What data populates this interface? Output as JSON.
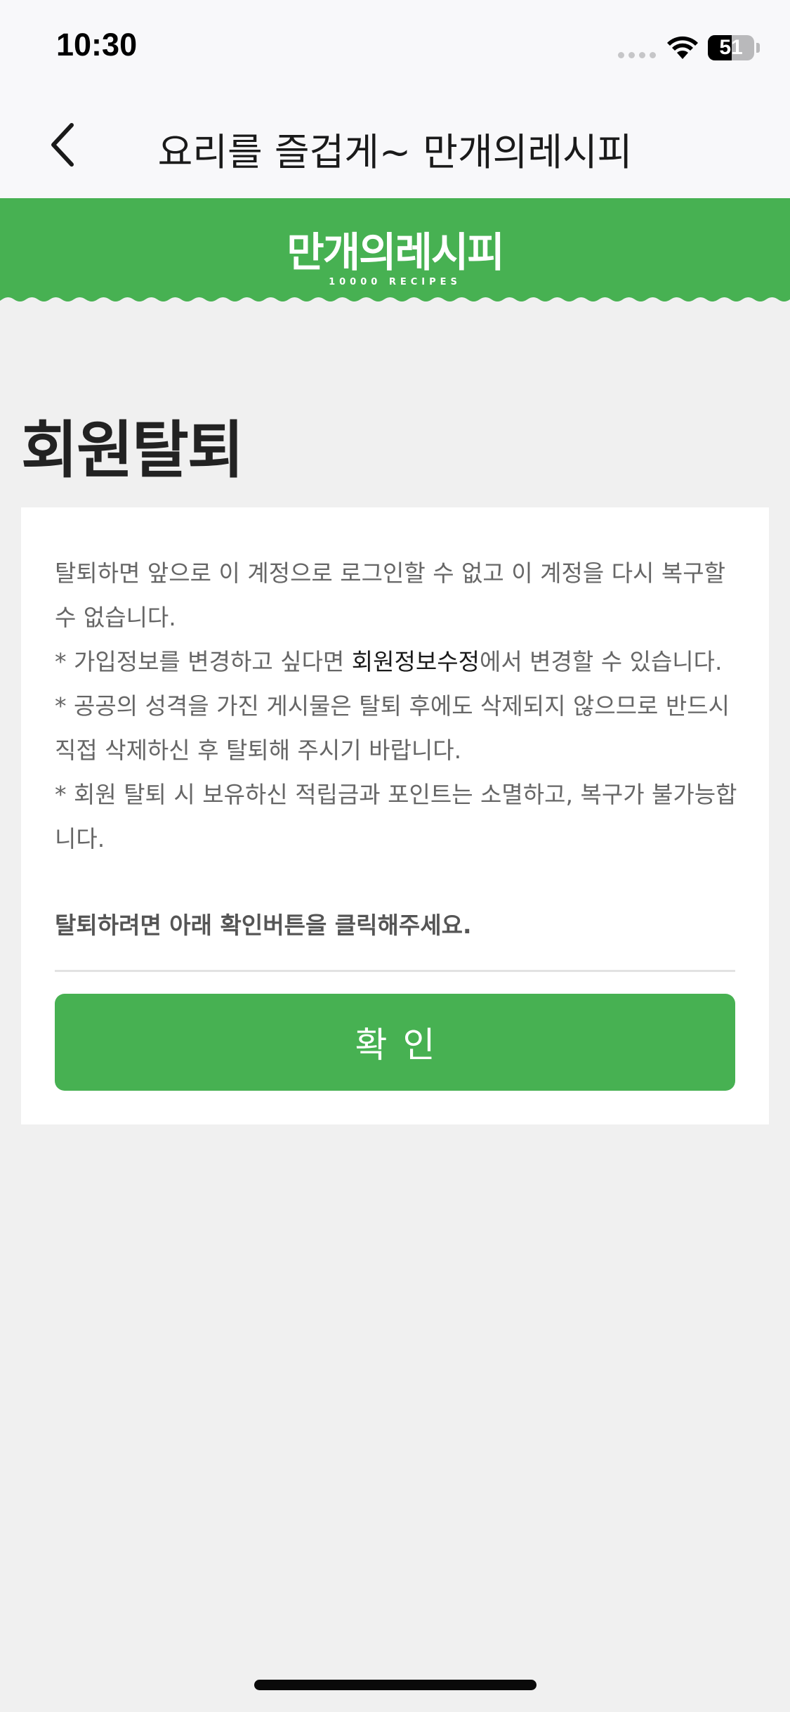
{
  "status_bar": {
    "time": "10:30",
    "battery_level": "51",
    "battery_fraction": 0.51
  },
  "nav": {
    "title": "요리를 즐겁게~ 만개의레시피",
    "back_icon": "chevron-left-icon"
  },
  "banner": {
    "logo": "만개의레시피",
    "logo_sub": "10000 RECIPES",
    "color": "#47b152"
  },
  "page": {
    "title": "회원탈퇴"
  },
  "notice": {
    "line1": "탈퇴하면 앞으로 이 계정으로 로그인할 수 없고 이 계정을 다시 복구할 수 없습니다.",
    "line2_prefix": "* 가입정보를 변경하고 싶다면 ",
    "line2_link": "회원정보수정",
    "line2_suffix": "에서 변경할 수 있습니다.",
    "line3": "* 공공의 성격을 가진 게시물은 탈퇴 후에도 삭제되지 않으므로 반드시 직접 삭제하신 후 탈퇴해 주시기 바랍니다.",
    "line4": "* 회원 탈퇴 시 보유하신 적립금과 포인트는 소멸하고, 복구가 불가능합니다."
  },
  "instruction": "탈퇴하려면 아래 확인버튼을 클릭해주세요.",
  "confirm_button": {
    "label": "확인"
  }
}
